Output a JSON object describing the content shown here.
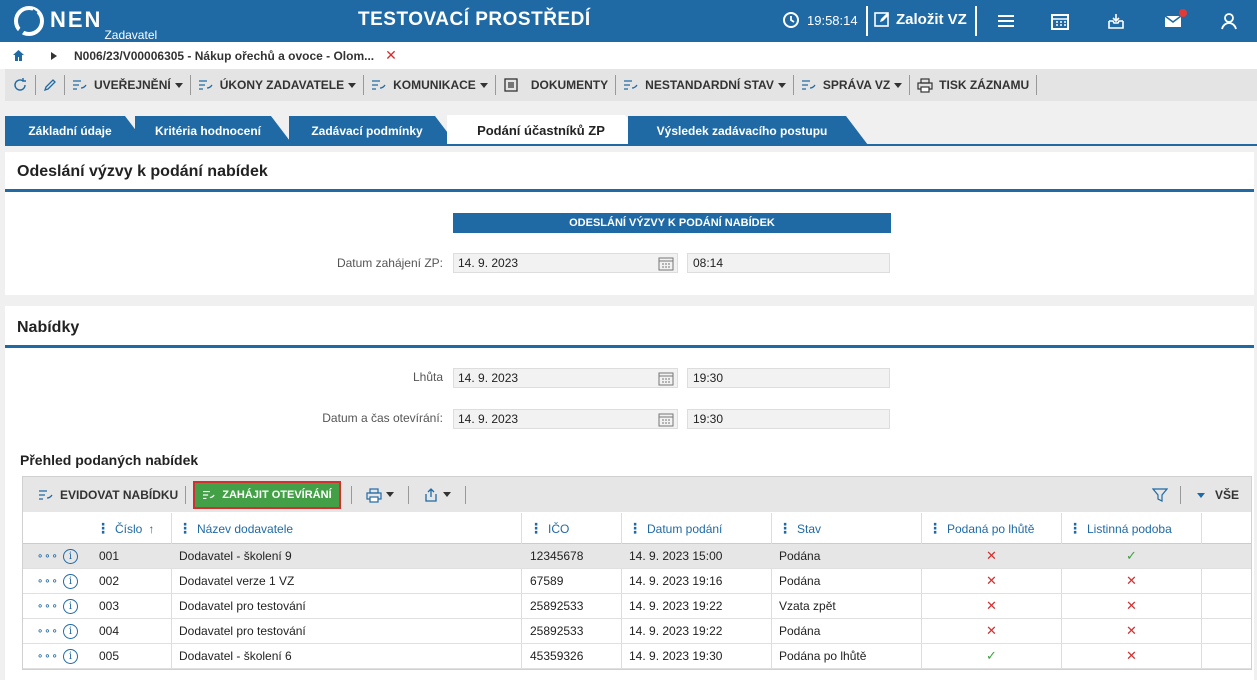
{
  "header": {
    "logo_text": "NEN",
    "logo_sub": "Zadavatel",
    "env_title": "TESTOVACÍ PROSTŘEDÍ",
    "time": "19:58:14",
    "create_label": "Založit VZ"
  },
  "breadcrumb": {
    "text": "N006/23/V00006305 - Nákup ořechů a ovoce - Olom...",
    "close": "✕"
  },
  "toolbar": {
    "publish": "UVEŘEJNĚNÍ",
    "acts": "ÚKONY ZADAVATELE",
    "comm": "KOMUNIKACE",
    "docs": "DOKUMENTY",
    "nonstandard": "NESTANDARDNÍ STAV",
    "manage": "SPRÁVA VZ",
    "print": "TISK ZÁZNAMU"
  },
  "tabs": [
    {
      "label": "Základní údaje"
    },
    {
      "label": "Kritéria hodnocení"
    },
    {
      "label": "Zadávací podmínky"
    },
    {
      "label": "Podání účastníků ZP"
    },
    {
      "label": "Výsledek zadávacího postupu"
    }
  ],
  "invite": {
    "title": "Odeslání výzvy k podání nabídek",
    "section_bar": "ODESLÁNÍ VÝZVY K PODÁNÍ NABÍDEK",
    "start_label": "Datum zahájení ZP:",
    "start_date": "14. 9. 2023",
    "start_time": "08:14"
  },
  "offers": {
    "title": "Nabídky",
    "deadline_label": "Lhůta",
    "deadline_date": "14. 9. 2023",
    "deadline_time": "19:30",
    "open_label": "Datum a čas otevírání:",
    "open_date": "14. 9. 2023",
    "open_time": "19:30",
    "overview_title": "Přehled podaných nabídek"
  },
  "grid": {
    "record_label": "EVIDOVAT NABÍDKU",
    "start_open_label": "ZAHÁJIT OTEVÍRÁNÍ",
    "all_label": "VŠE",
    "columns": {
      "number": "Číslo",
      "sort_icon": "↑",
      "supplier": "Název dodavatele",
      "ico": "IČO",
      "date": "Datum podání",
      "status": "Stav",
      "late": "Podaná po lhůtě",
      "paper": "Listinná podoba"
    },
    "more_glyph": "∘∘∘",
    "info_glyph": "i",
    "rows": [
      {
        "number": "001",
        "supplier": "Dodavatel - školení 9",
        "ico": "12345678",
        "date": "14. 9. 2023 15:00",
        "status": "Podána",
        "late": "✕",
        "paper": "✓"
      },
      {
        "number": "002",
        "supplier": "Dodavatel verze 1 VZ",
        "ico": "67589",
        "date": "14. 9. 2023 19:16",
        "status": "Podána",
        "late": "✕",
        "paper": "✕"
      },
      {
        "number": "003",
        "supplier": "Dodavatel pro testování",
        "ico": "25892533",
        "date": "14. 9. 2023 19:22",
        "status": "Vzata zpět",
        "late": "✕",
        "paper": "✕"
      },
      {
        "number": "004",
        "supplier": "Dodavatel pro testování",
        "ico": "25892533",
        "date": "14. 9. 2023 19:22",
        "status": "Podána",
        "late": "✕",
        "paper": "✕"
      },
      {
        "number": "005",
        "supplier": "Dodavatel - školení 6",
        "ico": "45359326",
        "date": "14. 9. 2023 19:30",
        "status": "Podána po lhůtě",
        "late": "✓",
        "paper": "✕"
      }
    ]
  },
  "colors": {
    "primary": "#1f6aa5",
    "success": "#43a047",
    "danger": "#d32f2f"
  }
}
